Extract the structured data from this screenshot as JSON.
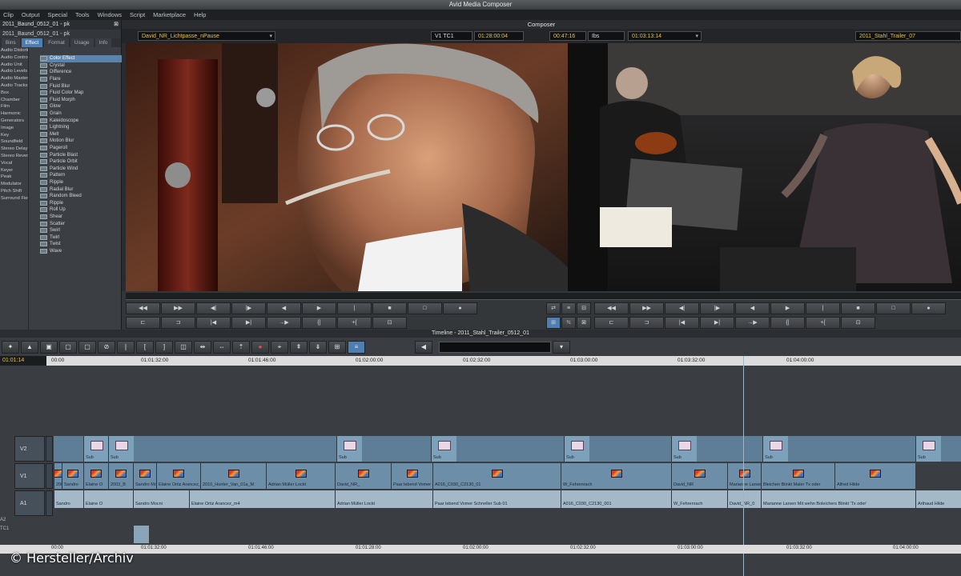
{
  "app": {
    "title": "Avid Media Composer"
  },
  "menu": [
    "Clip",
    "Output",
    "Special",
    "Tools",
    "Windows",
    "Script",
    "Marketplace",
    "Help"
  ],
  "bin": {
    "title": "2011_Baund_0512_01 - pk",
    "subtitle": "2011_Baund_0512_01 - pk",
    "tabs": [
      "Bins",
      "Effect",
      "Format",
      "Usage",
      "Info"
    ],
    "categories": [
      "Audio Distortion",
      "Audio Control",
      "Audio Unit",
      "Audio Levels",
      "Audio Mastering",
      "Audio Tracks",
      "Box",
      "Chamber",
      "Film",
      "Harmonic",
      "Generators",
      "Image",
      "Key",
      "Soundfield",
      "Stereo Delay",
      "Stereo Reverb",
      "Vocal",
      "Keyer",
      "Peak",
      "Modulator",
      "Pitch Shift",
      "Surround Field"
    ],
    "effects": [
      "Color Effect",
      "Crystal",
      "Difference",
      "Flare",
      "Fluid Blur",
      "Fluid Color Map",
      "Fluid Morph",
      "Glow",
      "Grain",
      "Kaleidoscope",
      "Lightning",
      "Melt",
      "Motion Blur",
      "Pageroll",
      "Particle Blast",
      "Particle Orbit",
      "Particle Wind",
      "Pattern",
      "Ripple",
      "Radial Blur",
      "Random Bleed",
      "Ripple",
      "Roll Up",
      "Shear",
      "Scatter",
      "Swirl",
      "Twirl",
      "Twist",
      "Wave"
    ]
  },
  "composer": {
    "title": "Composer",
    "source_clip": "David_NR_Lichtpasse_nPause",
    "track_indicator": "V1 TC1",
    "source_tc": "01:28:00:04",
    "duration": "00:47:16",
    "mark_label": "Ibs",
    "record_tc": "01:03:13:14",
    "record_sequence": "2011_Stahl_Trailer_07"
  },
  "source_buttons_row1": [
    "◀◀",
    "▶▶",
    "◀|",
    "|▶",
    "◀",
    "▶",
    "|",
    "■",
    "□",
    "●"
  ],
  "source_buttons_row2": [
    "⊏",
    "⊐",
    "|◀",
    "▶|",
    "→▶",
    "{|",
    "+{",
    "⊡"
  ],
  "record_buttons_row1": [
    "◀◀",
    "▶▶",
    "◀|",
    "|▶",
    "◀",
    "▶",
    "|",
    "■",
    "□",
    "●"
  ],
  "record_buttons_row2": [
    "⊏",
    "⊐",
    "|◀",
    "▶|",
    "→▶",
    "{|",
    "+{",
    "⊡"
  ],
  "timeline": {
    "title": "Timeline - 2011_Stahl_Trailer_0512_01",
    "position_tc": "01:01:14",
    "ruler_ticks": [
      "00:00",
      "01:01:32:00",
      "01:01:46:00",
      "01:02:00:00",
      "01:02:32:00",
      "01:03:00:00",
      "01:03:32:00",
      "01:04:00:00"
    ],
    "bottom_ticks": [
      "00:00",
      "01:01:32:00",
      "01:01:46:00",
      "01:01:28:00",
      "01:02:00:00",
      "01:02:32:00",
      "01:03:00:00",
      "01:03:32:00",
      "01:04:00:00"
    ],
    "tracks": [
      "V2",
      "V1",
      "A1",
      "A2",
      "TC1"
    ],
    "v2_clips": [
      "Sub",
      "Sub",
      "Sub",
      "Sub",
      "Sub",
      "Sub",
      "Sub",
      "Sub"
    ],
    "v1_clips": [
      "2003_",
      "Sandro",
      "Elaine O",
      "2003_B",
      "Sandro Mocni",
      "Elaine Ortiz Arancez_m",
      "2010_Hunter_Van_01a_M",
      "Adrian Müller Lockt",
      "David_NR_",
      "Paar lebend Vomer Schneller Sub 01",
      "A016_C030_C2130_01",
      "W_Fehrenrach",
      "David_NR",
      "Marianne Larsen Mit wehn",
      "Bleichen Blinkt Maler Tx oder",
      "Alfred Hilde"
    ],
    "a1_clips": [
      "Sandro",
      "Elaine O",
      "Sandro Mocni",
      "Elaine Ortiz Arancez_m4",
      "Adrian Müller Lockt",
      "Paar lebend Vomer Schneller Sub 01",
      "A016_C030_C2130_001",
      "W_Fehrenrach",
      "David_NR_0",
      "Marianne Larsen Mit wehn Boleichers Blinkt 'Tx oder'",
      "Arthaud Hilde"
    ]
  },
  "watermark": "© Hersteller/Archiv"
}
